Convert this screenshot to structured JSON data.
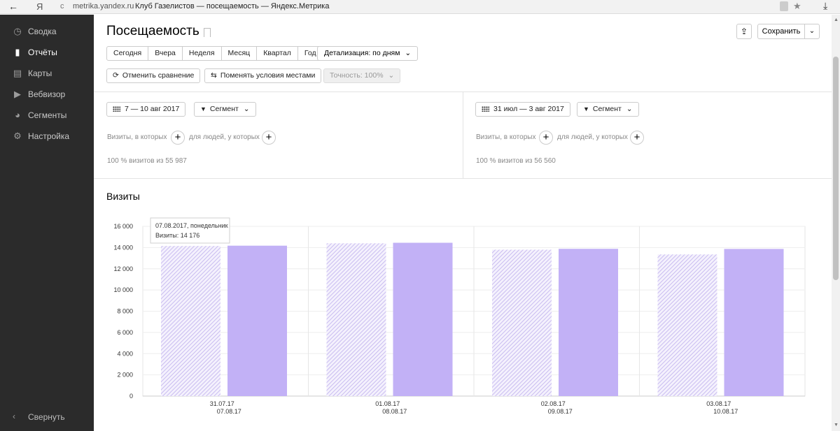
{
  "browser": {
    "back_glyph": "←",
    "ya_glyph": "Я",
    "url": "metrika.yandex.ru",
    "title": "Клуб Газелистов — посещаемость — Яндекс.Метрика"
  },
  "sidebar": {
    "items": [
      {
        "label": "Сводка",
        "icon": "gauge-icon",
        "glyph": "◷"
      },
      {
        "label": "Отчёты",
        "icon": "bar-chart-icon",
        "glyph": "▮"
      },
      {
        "label": "Карты",
        "icon": "map-icon",
        "glyph": "▤"
      },
      {
        "label": "Вебвизор",
        "icon": "play-icon",
        "glyph": "▶"
      },
      {
        "label": "Сегменты",
        "icon": "pie-icon",
        "glyph": "◕"
      },
      {
        "label": "Настройка",
        "icon": "gear-icon",
        "glyph": "⚙"
      }
    ],
    "active_index": 1,
    "collapse_label": "Свернуть"
  },
  "header": {
    "title": "Посещаемость",
    "save_label": "Сохранить"
  },
  "periods": [
    "Сегодня",
    "Вчера",
    "Неделя",
    "Месяц",
    "Квартал",
    "Год"
  ],
  "detail_label": "Детализация: по дням",
  "compare": {
    "cancel_label": "Отменить сравнение",
    "swap_label": "Поменять условия местами",
    "accuracy_label": "Точность: 100%"
  },
  "segments": {
    "left": {
      "date_label": "7 — 10 авг 2017",
      "segment_label": "Сегмент",
      "visits_where": "Визиты, в которых",
      "people_where": "для людей, у которых",
      "summary": "100 % визитов из 55 987"
    },
    "right": {
      "date_label": "31 июл — 3 авг 2017",
      "segment_label": "Сегмент",
      "visits_where": "Визиты, в которых",
      "people_where": "для людей, у которых",
      "summary": "100 % визитов из 56 560"
    }
  },
  "chart_title": "Визиты",
  "tooltip": {
    "line1": "07.08.2017, понедельник",
    "line2": "Визиты: 14 176"
  },
  "colors": {
    "bar_solid": "#c2b1f6",
    "bar_hatched": "#c9bcf0",
    "sidebar_bg": "#2b2b2b"
  },
  "chart_data": {
    "type": "bar",
    "title": "Визиты",
    "ylim": [
      0,
      16000
    ],
    "yticks": [
      0,
      2000,
      4000,
      6000,
      8000,
      10000,
      12000,
      14000,
      16000
    ],
    "ytick_labels": [
      "0",
      "2 000",
      "4 000",
      "6 000",
      "8 000",
      "10 000",
      "12 000",
      "14 000",
      "16 000"
    ],
    "grid": true,
    "groups": [
      {
        "label_top": "31.07.17",
        "label_bottom": "07.08.17",
        "hatched": 14150,
        "solid": 14176
      },
      {
        "label_top": "01.08.17",
        "label_bottom": "08.08.17",
        "hatched": 14400,
        "solid": 14450
      },
      {
        "label_top": "02.08.17",
        "label_bottom": "09.08.17",
        "hatched": 13800,
        "solid": 13880
      },
      {
        "label_top": "03.08.17",
        "label_bottom": "10.08.17",
        "hatched": 13350,
        "solid": 13870
      }
    ]
  }
}
